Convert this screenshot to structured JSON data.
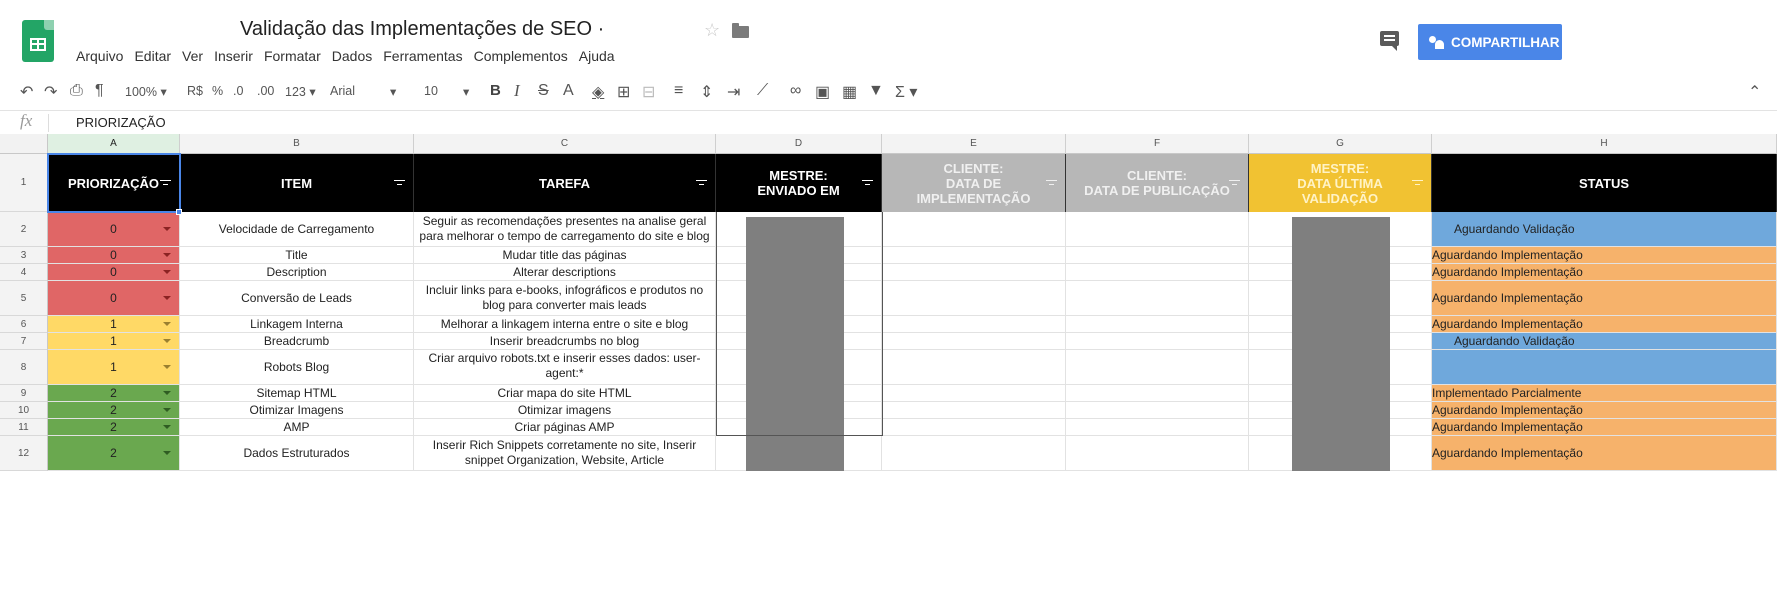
{
  "doc": {
    "title": "Validação das Implementações de SEO ·",
    "menu": [
      "Arquivo",
      "Editar",
      "Ver",
      "Inserir",
      "Formatar",
      "Dados",
      "Ferramentas",
      "Complementos",
      "Ajuda"
    ],
    "share_label": "COMPARTILHAR"
  },
  "toolbar": {
    "zoom": "100% ▾",
    "currency": "R$",
    "percent": "%",
    "dec_less": ".0",
    "dec_more": ".00",
    "num_format": "123 ▾",
    "font": "Arial",
    "font_size": "10",
    "bold": "B",
    "italic": "I",
    "strike": "S",
    "text_color": "A",
    "sum": "Σ ▾"
  },
  "formula": {
    "value": "PRIORIZAÇÃO"
  },
  "columns": [
    "A",
    "B",
    "C",
    "D",
    "E",
    "F",
    "G",
    "H"
  ],
  "header_row": {
    "number": "1",
    "labels": [
      "PRIORIZAÇÃO",
      "ITEM",
      "TAREFA",
      "MESTRE:\nENVIADO EM",
      "CLIENTE:\nDATA DE\nIMPLEMENTAÇÃO",
      "CLIENTE:\nDATA DE PUBLICAÇÃO",
      "MESTRE:\nDATA ÚLTIMA\nVALIDAÇÃO",
      "STATUS"
    ]
  },
  "rows": [
    {
      "n": "2",
      "priority": "0",
      "item": "Velocidade de Carregamento",
      "task": "Seguir as recomendações presentes na analise geral para melhorar o tempo de carregamento do site e blog",
      "status": "Aguardando Validação"
    },
    {
      "n": "3",
      "priority": "0",
      "item": "Title",
      "task": "Mudar title das páginas",
      "status": "Aguardando Implementação"
    },
    {
      "n": "4",
      "priority": "0",
      "item": "Description",
      "task": "Alterar descriptions",
      "status": "Aguardando Implementação"
    },
    {
      "n": "5",
      "priority": "0",
      "item": "Conversão de Leads",
      "task": "Incluir links para e-books, infográficos e produtos no blog para converter mais leads",
      "status": "Aguardando Implementação"
    },
    {
      "n": "6",
      "priority": "1",
      "item": "Linkagem Interna",
      "task": "Melhorar a linkagem interna entre o site e blog",
      "status": "Aguardando Implementação"
    },
    {
      "n": "7",
      "priority": "1",
      "item": "Breadcrumb",
      "task": "Inserir breadcrumbs no blog",
      "status": "Aguardando Validação"
    },
    {
      "n": "8",
      "priority": "1",
      "item": "Robots Blog",
      "task": "Criar arquivo robots.txt e inserir esses dados: user-agent:*",
      "status": ""
    },
    {
      "n": "9",
      "priority": "2",
      "item": "Sitemap HTML",
      "task": "Criar mapa do site HTML",
      "status": "Implementado Parcialmente"
    },
    {
      "n": "10",
      "priority": "2",
      "item": "Otimizar Imagens",
      "task": "Otimizar imagens",
      "status": "Aguardando Implementação"
    },
    {
      "n": "11",
      "priority": "2",
      "item": "AMP",
      "task": "Criar páginas AMP",
      "status": "Aguardando Implementação"
    },
    {
      "n": "12",
      "priority": "2",
      "item": "Dados Estruturados",
      "task": "Inserir Rich Snippets corretamente no site, Inserir snippet Organization, Website, Article",
      "status": "Aguardando Implementação"
    }
  ],
  "colors": {
    "priority_0": "#e06666",
    "priority_1": "#ffd966",
    "priority_2": "#6aa84f",
    "status_blue": "#6fa8dc",
    "status_orange": "#f6b26b",
    "header_black": "#000000",
    "header_gray": "#b7b7b7",
    "header_gold": "#f1c232",
    "share_button": "#4a86e8"
  }
}
